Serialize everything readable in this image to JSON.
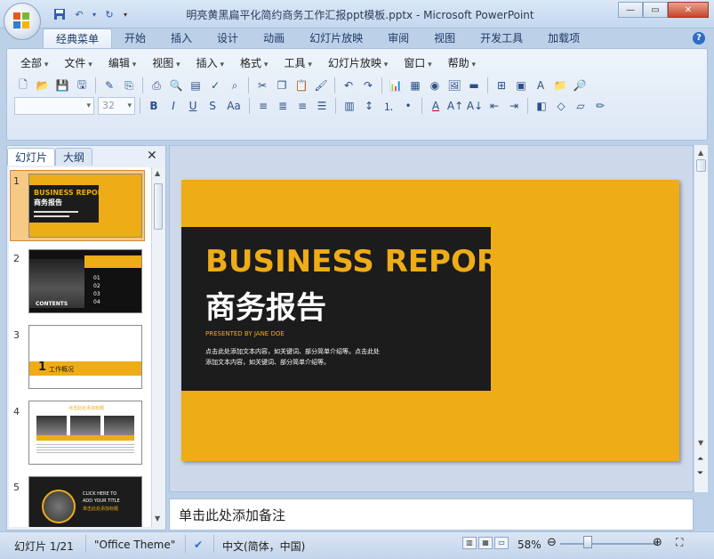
{
  "window": {
    "title": "明亮黄黑扁平化简约商务工作汇报ppt模板.pptx - Microsoft PowerPoint"
  },
  "ribbon_tabs": [
    "经典菜单",
    "开始",
    "插入",
    "设计",
    "动画",
    "幻灯片放映",
    "审阅",
    "视图",
    "开发工具",
    "加载项"
  ],
  "menus": [
    "全部",
    "文件",
    "编辑",
    "视图",
    "插入",
    "格式",
    "工具",
    "幻灯片放映",
    "窗口",
    "帮助"
  ],
  "font_combo": {
    "name": "",
    "size": "32"
  },
  "pane": {
    "tabs": [
      "幻灯片",
      "大纲"
    ],
    "close": "✕"
  },
  "thumbnails": [
    {
      "num": "1",
      "title_en": "BUSINESS REPORT",
      "title_cn": "商务报告"
    },
    {
      "num": "2",
      "label": "CONTENTS",
      "items": [
        "01",
        "02",
        "03",
        "04"
      ]
    },
    {
      "num": "3",
      "big": "1",
      "label": "工作概况"
    },
    {
      "num": "4",
      "title": "点击此处添加标题"
    },
    {
      "num": "5",
      "line1": "CLICK HERE TO",
      "line2": "ADD YOUR TITLE",
      "line3": "单击此处添加标题"
    }
  ],
  "slide": {
    "title_en": "BUSINESS REPORT",
    "title_cn": "商务报告",
    "presented": "PRESENTED BY JANE DOE",
    "desc1": "点击此处添加文本内容，如关键词、部分简单介绍等。点击此处",
    "desc2": "添加文本内容，如关键词、部分简单介绍等。",
    "colors": {
      "yellow": "#eeac17",
      "dark": "#1c1c1c"
    }
  },
  "notes_placeholder": "单击此处添加备注",
  "status": {
    "slide_info": "幻灯片 1/21",
    "theme": "\"Office Theme\"",
    "language": "中文(简体，中国)",
    "zoom": "58%"
  }
}
